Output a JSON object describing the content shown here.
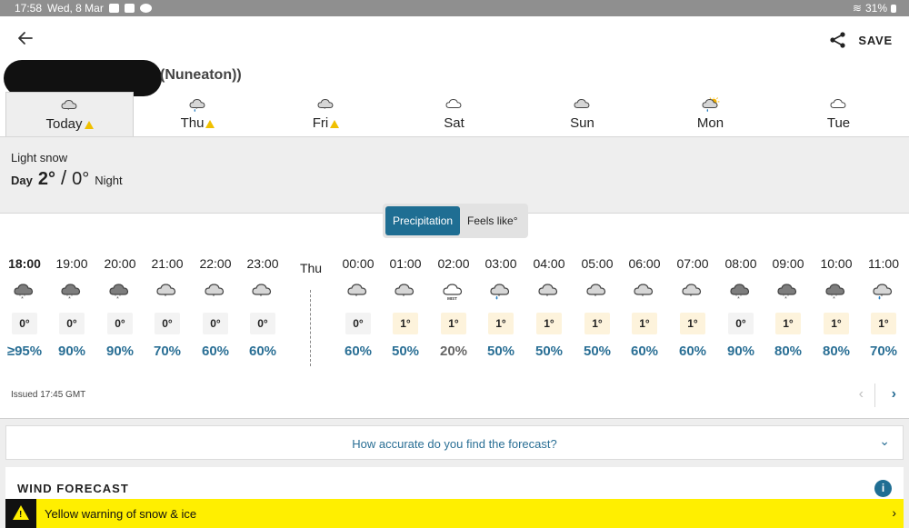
{
  "status_bar": {
    "time": "17:58",
    "date": "Wed, 8 Mar",
    "battery": "31%"
  },
  "header": {
    "save_label": "SAVE",
    "location_suffix": "(Nuneaton))"
  },
  "day_tabs": [
    {
      "label": "Today",
      "icon": "cloud-snow-icon",
      "warning": true,
      "active": true
    },
    {
      "label": "Thu",
      "icon": "cloud-sleet-icon",
      "warning": true,
      "active": false
    },
    {
      "label": "Fri",
      "icon": "cloud-snow-icon",
      "warning": true,
      "active": false
    },
    {
      "label": "Sat",
      "icon": "cloud-icon",
      "warning": false,
      "active": false
    },
    {
      "label": "Sun",
      "icon": "overcast-cloud-icon",
      "warning": false,
      "active": false
    },
    {
      "label": "Mon",
      "icon": "sun-cloud-shower-icon",
      "warning": false,
      "active": false
    },
    {
      "label": "Tue",
      "icon": "cloud-icon",
      "warning": false,
      "active": false
    }
  ],
  "summary": {
    "condition": "Light snow",
    "day_label": "Day",
    "day_temp": "2°",
    "separator": "/",
    "night_temp": "0°",
    "night_label": "Night"
  },
  "toggle": {
    "precipitation": "Precipitation",
    "feels_like": "Feels like°"
  },
  "hourly": [
    {
      "time": "18:00",
      "icon": "heavy-snow-icon",
      "temp": "0°",
      "prob": "≥95%",
      "now": true
    },
    {
      "time": "19:00",
      "icon": "heavy-snow-icon",
      "temp": "0°",
      "prob": "90%"
    },
    {
      "time": "20:00",
      "icon": "heavy-snow-icon",
      "temp": "0°",
      "prob": "90%"
    },
    {
      "time": "21:00",
      "icon": "light-snow-icon",
      "temp": "0°",
      "prob": "70%"
    },
    {
      "time": "22:00",
      "icon": "light-snow-icon",
      "temp": "0°",
      "prob": "60%"
    },
    {
      "time": "23:00",
      "icon": "light-snow-icon",
      "temp": "0°",
      "prob": "60%"
    },
    {
      "time": "00:00",
      "icon": "light-snow-icon",
      "temp": "0°",
      "prob": "60%"
    },
    {
      "time": "01:00",
      "icon": "light-snow-icon",
      "temp": "1°",
      "prob": "50%"
    },
    {
      "time": "02:00",
      "icon": "mist-icon",
      "temp": "1°",
      "prob": "20%",
      "icon_text": "MIST"
    },
    {
      "time": "03:00",
      "icon": "sleet-icon",
      "temp": "1°",
      "prob": "50%"
    },
    {
      "time": "04:00",
      "icon": "light-snow-icon",
      "temp": "1°",
      "prob": "50%"
    },
    {
      "time": "05:00",
      "icon": "light-snow-icon",
      "temp": "1°",
      "prob": "50%"
    },
    {
      "time": "06:00",
      "icon": "light-snow-icon",
      "temp": "1°",
      "prob": "60%"
    },
    {
      "time": "07:00",
      "icon": "light-snow-icon",
      "temp": "1°",
      "prob": "60%"
    },
    {
      "time": "08:00",
      "icon": "heavy-snow-icon",
      "temp": "0°",
      "prob": "90%"
    },
    {
      "time": "09:00",
      "icon": "heavy-snow-icon",
      "temp": "1°",
      "prob": "80%"
    },
    {
      "time": "10:00",
      "icon": "heavy-snow-icon",
      "temp": "1°",
      "prob": "80%"
    },
    {
      "time": "11:00",
      "icon": "sleet-icon",
      "temp": "1°",
      "prob": "70%"
    }
  ],
  "day_divider": "Thu",
  "issued": "Issued 17:45 GMT",
  "feedback_label": "How accurate do you find the forecast?",
  "wind_title": "WIND FORECAST",
  "warning_text": "Yellow warning of snow & ice",
  "colors": {
    "accent": "#1f6e93",
    "warning_yellow": "#ffef00",
    "warning_triangle": "#f0c000"
  }
}
